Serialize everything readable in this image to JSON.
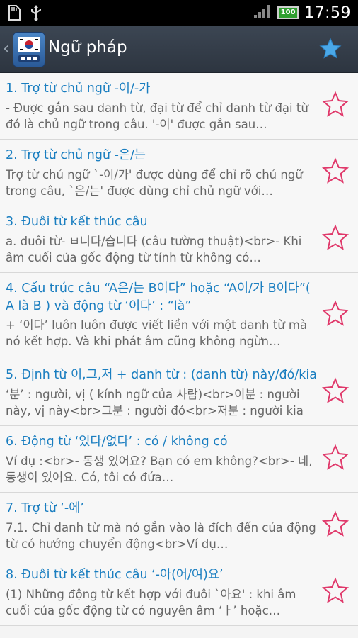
{
  "statusbar": {
    "time": "17:59",
    "battery": "100",
    "icons": [
      "sd-card-icon",
      "usb-icon",
      "signal-icon"
    ]
  },
  "header": {
    "title": "Ngữ pháp",
    "back_icon": "chevron-left-icon",
    "logo_icon": "korean-flag-app-icon",
    "action_icon": "star-icon",
    "accent": "#4aa8e8"
  },
  "colors": {
    "title_text": "#1a7ec0",
    "desc_text": "#666666",
    "fav_star": "#e0386a"
  },
  "items": [
    {
      "title": "1. Trợ từ chủ ngữ -이/-가",
      "desc": "- Được gắn sau danh từ, đại từ để chỉ danh từ đại từ đó là chủ ngữ trong câu. '-이' được gắn sau…"
    },
    {
      "title": "2. Trợ từ chủ ngữ -은/는",
      "desc": "Trợ từ chủ ngữ `-이/가' được dùng để chỉ rõ chủ ngữ trong câu, `은/는' được dùng chỉ chủ ngữ với…"
    },
    {
      "title": "3. Đuôi từ kết thúc câu",
      "desc": "a. đuôi từ- ㅂ니다/습니다 (câu tường thuật)<br>- Khi âm cuối của gốc động từ tính từ không có…"
    },
    {
      "title": "4. Cấu trúc câu “A은/는 B이다” hoặc “A이/가 B이다”( A là B ) và động từ ‘이다’ : “là”",
      "desc": "+ ‘이다’ luôn luôn được viết liền với một danh từ mà nó kết hợp. Và khi phát âm cũng không ngừn…"
    },
    {
      "title": "5. Định từ 이,그,저 + danh từ : (danh từ) này/đó/kia",
      "desc": "‘분’ : người, vị ( kính ngữ của 사람)<br>이분 : người này, vị này<br>그분 : người đó<br>저분 : người kia"
    },
    {
      "title": "6. Động từ ‘있다/없다’ : có / không có",
      "desc": "Ví dụ :<br>- 동생 있어요? Bạn có em không?<br>- 네, 동생이 있어요. Có, tôi có đứa…"
    },
    {
      "title": "7. Trợ từ ‘-에’",
      "desc": "7.1. Chỉ danh từ mà nó gắn vào là đích đến của động từ có hướng chuyển động<br>Ví dụ…"
    },
    {
      "title": "8. Đuôi từ kết thúc câu ‘-아(어/여)요’",
      "desc": "(1) Những động từ kết hợp với đuôi `아요' : khi âm cuối của gốc động từ có nguyên âm ‘ㅏ’ hoặc…"
    }
  ]
}
